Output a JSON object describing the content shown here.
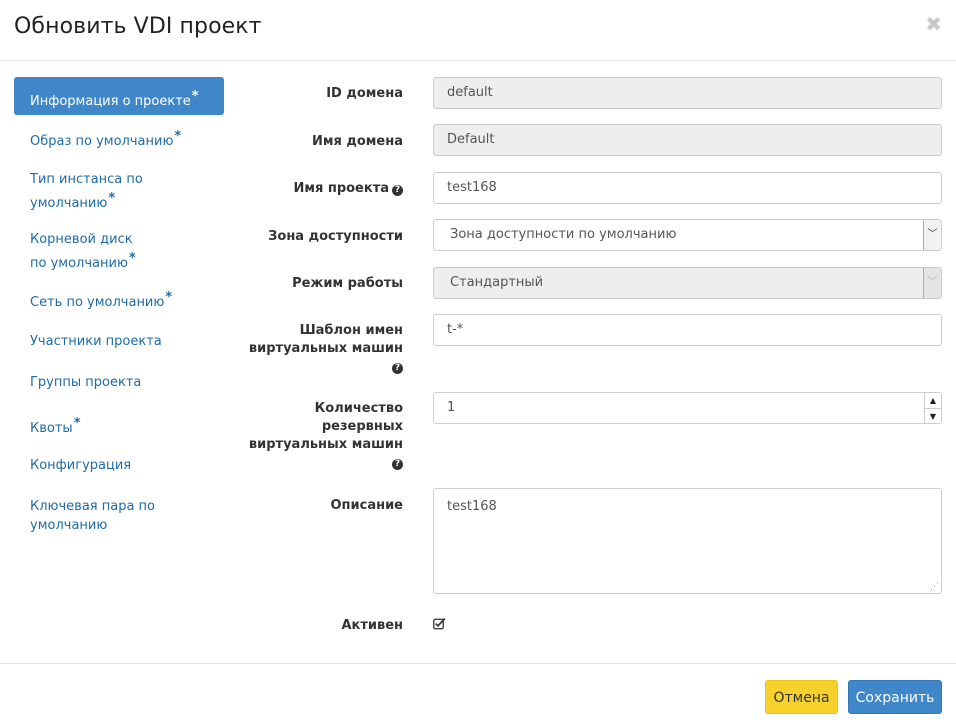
{
  "dialog": {
    "title": "Обновить VDI проект"
  },
  "nav": {
    "items": [
      {
        "label": "Информация о проекте",
        "required": "*",
        "active": true
      },
      {
        "label": "Образ по умолчанию",
        "required": "*"
      },
      {
        "label": "Тип инстанса по умолчанию",
        "required": "*"
      },
      {
        "label": "Корневой диск по умолчанию",
        "required": "*"
      },
      {
        "label": "Сеть по умолчанию",
        "required": "*"
      },
      {
        "label": "Участники проекта",
        "required": ""
      },
      {
        "label": "Группы проекта",
        "required": ""
      },
      {
        "label": "Квоты",
        "required": "*"
      },
      {
        "label": "Конфигурация",
        "required": ""
      },
      {
        "label": "Ключевая пара по умолчанию",
        "required": ""
      }
    ]
  },
  "form": {
    "domain_id": {
      "label": "ID домена",
      "value": "default"
    },
    "domain_name": {
      "label": "Имя домена",
      "value": "Default"
    },
    "project_name": {
      "label": "Имя проекта",
      "value": "test168"
    },
    "availability_zone": {
      "label": "Зона доступности",
      "value": "Зона доступности по умолчанию"
    },
    "mode": {
      "label": "Режим работы",
      "value": "Стандартный"
    },
    "vm_name_template": {
      "label_line1": "Шаблон имен",
      "label_line2": "виртуальных машин",
      "value": "t-*"
    },
    "reserve_vm_count": {
      "label_line1": "Количество",
      "label_line2": "резервных",
      "label_line3": "виртуальных машин",
      "value": "1"
    },
    "description": {
      "label": "Описание",
      "value": "test168"
    },
    "active": {
      "label": "Активен",
      "checked": true
    }
  },
  "footer": {
    "cancel_label": "Отмена",
    "save_label": "Сохранить"
  },
  "colors": {
    "accent": "#3f87c9",
    "cancel": "#f6d12b",
    "link": "#1f6aa9"
  }
}
